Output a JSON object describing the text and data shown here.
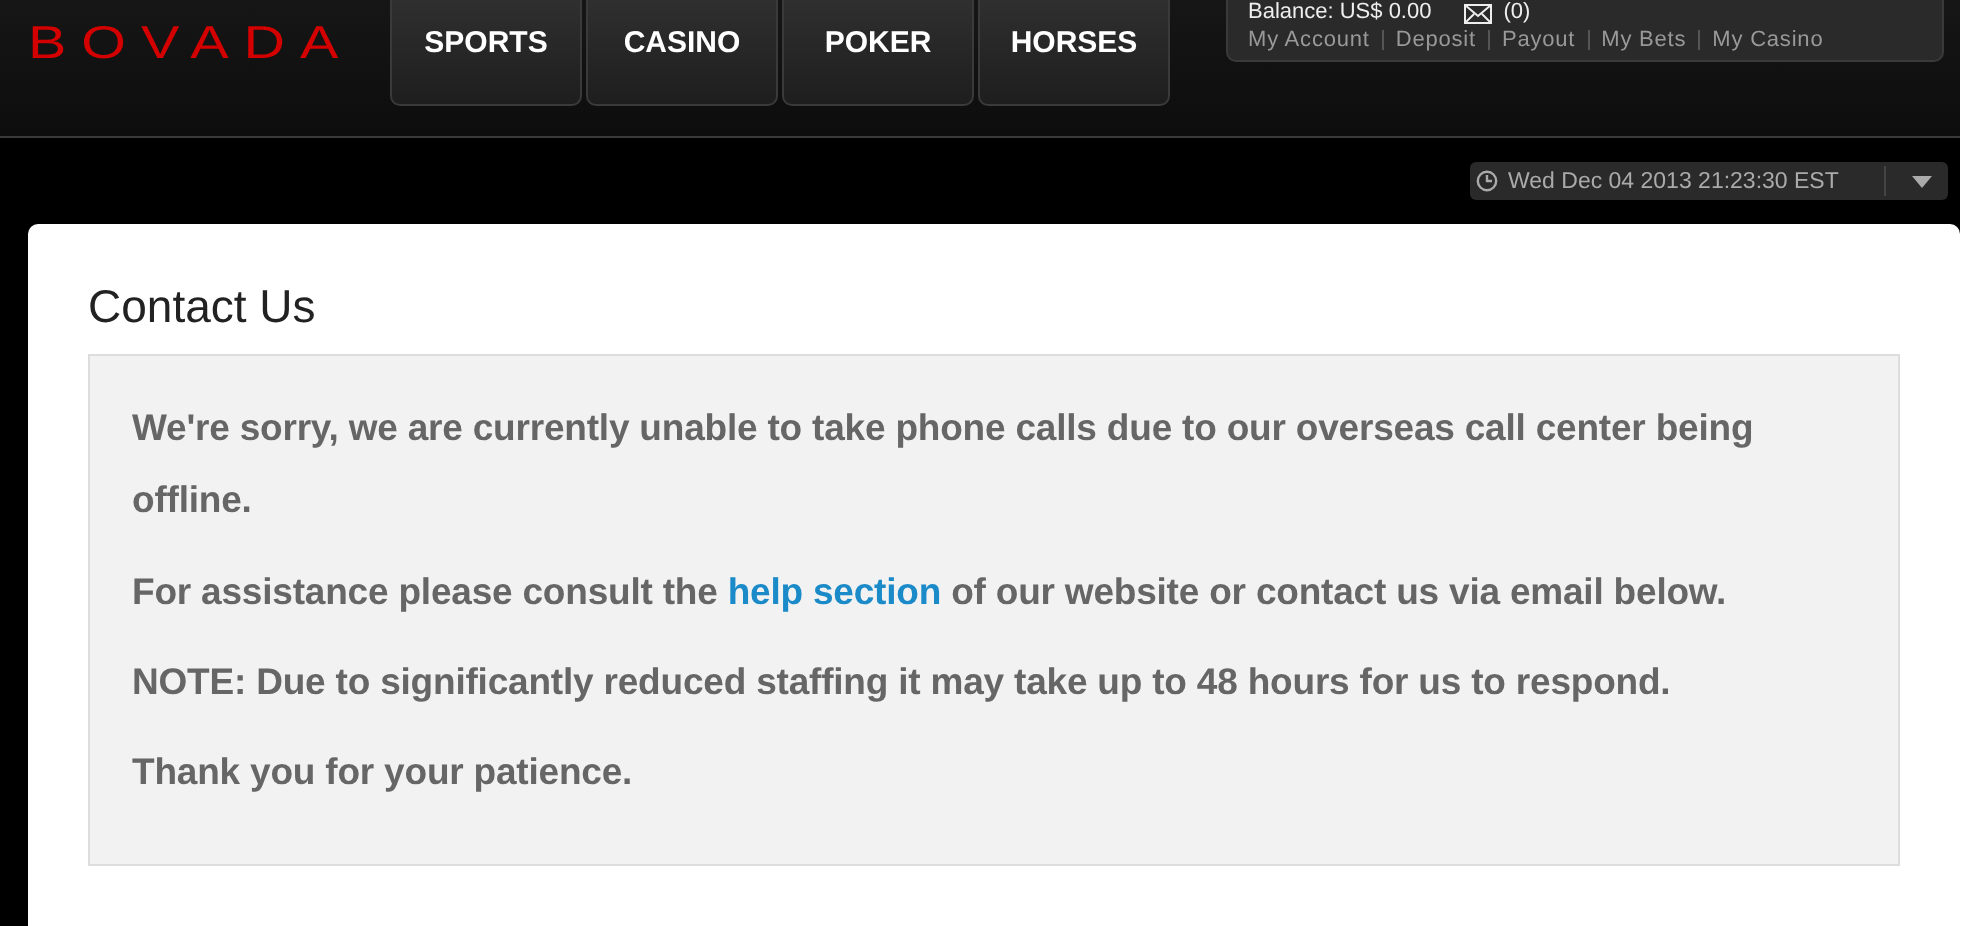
{
  "logo": "BOVADA",
  "nav": [
    {
      "label": "SPORTS"
    },
    {
      "label": "CASINO"
    },
    {
      "label": "POKER"
    },
    {
      "label": "HORSES"
    }
  ],
  "account": {
    "balance": "Balance: US$ 0.00",
    "messages": "(0)",
    "links": [
      "My Account",
      "Deposit",
      "Payout",
      "My Bets",
      "My Casino"
    ]
  },
  "datetime": "Wed Dec 04 2013 21:23:30 EST",
  "page": {
    "title": "Contact Us",
    "paragraphs": [
      {
        "text": "We're sorry, we are currently unable to take phone calls due to our overseas call center being offline."
      },
      {
        "text": "For assistance please consult the",
        "link": "help section",
        "after": "of our website or contact us via email below."
      },
      {
        "text": "NOTE: Due to significantly reduced staffing it may take up to 48 hours for us to respond."
      },
      {
        "text": "Thank you for your patience."
      }
    ]
  }
}
